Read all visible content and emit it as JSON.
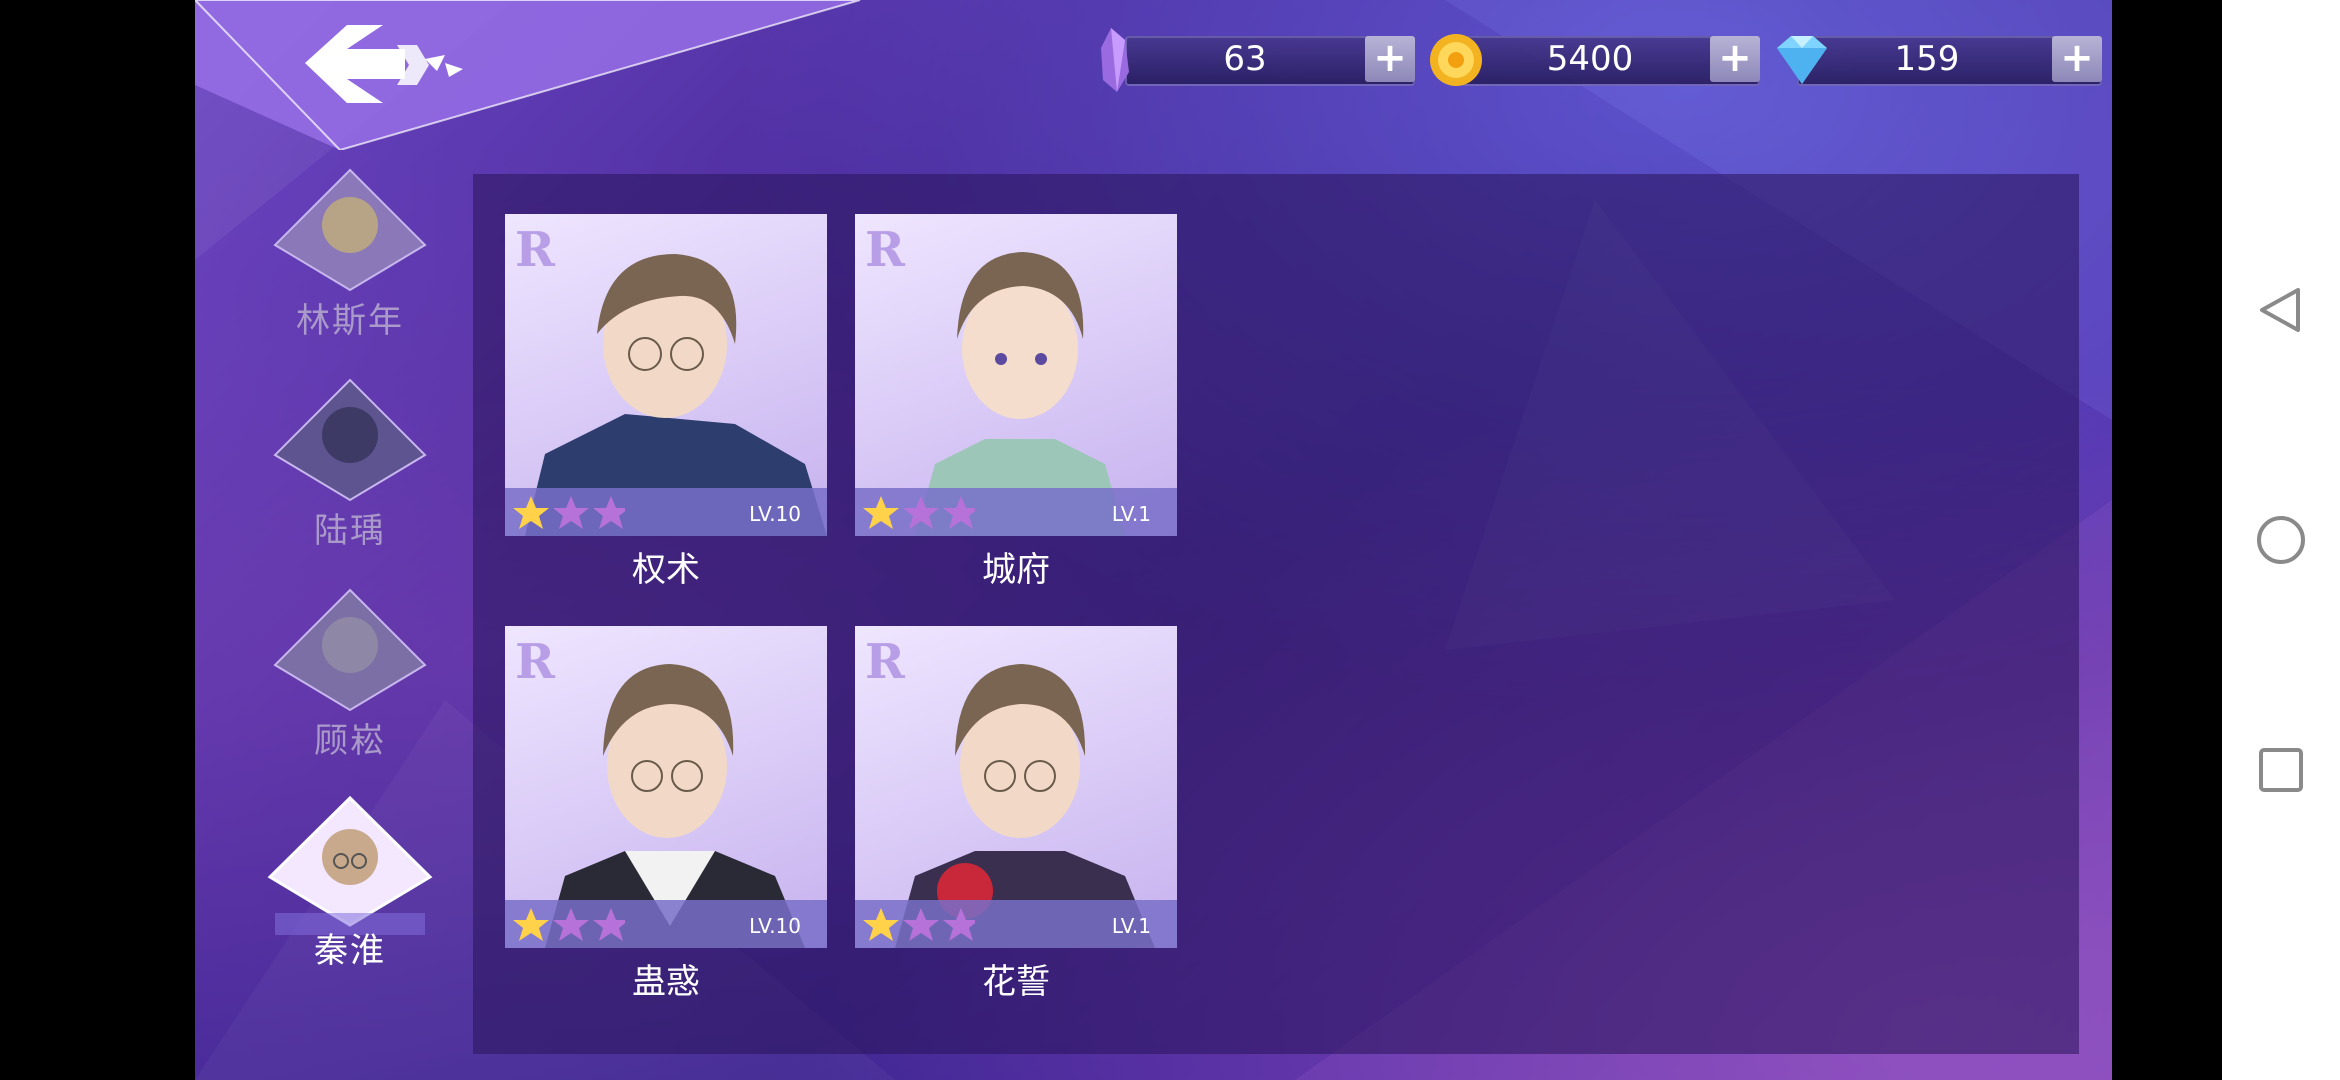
{
  "header": {
    "back_label": "返回"
  },
  "currencies": [
    {
      "icon": "crystal-icon",
      "amount": "63",
      "plus": "+"
    },
    {
      "icon": "gold-coin-icon",
      "amount": "5400",
      "plus": "+"
    },
    {
      "icon": "diamond-icon",
      "amount": "159",
      "plus": "+"
    }
  ],
  "characters": [
    {
      "name": "林斯年",
      "active": false
    },
    {
      "name": "陆瑀",
      "active": false
    },
    {
      "name": "顾崧",
      "active": false
    },
    {
      "name": "秦淮",
      "active": true
    }
  ],
  "cards": [
    {
      "rank": "R",
      "name": "权术",
      "level": "LV.10",
      "stars_filled": 1,
      "stars_total": 3
    },
    {
      "rank": "R",
      "name": "城府",
      "level": "LV.1",
      "stars_filled": 1,
      "stars_total": 3
    },
    {
      "rank": "R",
      "name": "蛊惑",
      "level": "LV.10",
      "stars_filled": 1,
      "stars_total": 3
    },
    {
      "rank": "R",
      "name": "花誓",
      "level": "LV.1",
      "stars_filled": 1,
      "stars_total": 3
    }
  ],
  "navbar": {
    "back": "back-triangle-icon",
    "home": "home-circle-icon",
    "recents": "recents-square-icon"
  }
}
